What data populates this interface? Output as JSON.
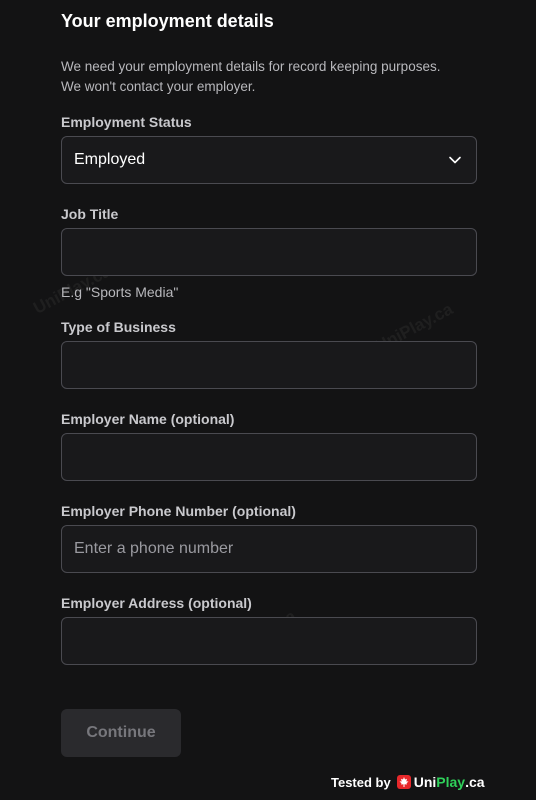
{
  "form": {
    "title": "Your employment details",
    "intro_line1": "We need your employment details for record keeping purposes.",
    "intro_line2": "We won't contact your employer.",
    "employment_status": {
      "label": "Employment Status",
      "value": "Employed"
    },
    "job_title": {
      "label": "Job Title",
      "value": "",
      "placeholder": "",
      "hint": "E.g \"Sports Media\""
    },
    "type_of_business": {
      "label": "Type of Business",
      "value": "",
      "placeholder": ""
    },
    "employer_name": {
      "label": "Employer Name (optional)",
      "value": "",
      "placeholder": ""
    },
    "employer_phone": {
      "label": "Employer Phone Number (optional)",
      "value": "",
      "placeholder": "Enter a phone number"
    },
    "employer_address": {
      "label": "Employer Address (optional)",
      "value": "",
      "placeholder": ""
    },
    "continue_label": "Continue"
  },
  "footer": {
    "tested_by": "Tested by",
    "brand_uni": "Uni",
    "brand_play": "Play",
    "brand_ca": ".ca"
  },
  "watermarks": [
    "UniPlay.ca",
    "UniPlay.ca",
    "UniPlay.ca"
  ],
  "colors": {
    "background": "#131314",
    "accent_green": "#2fd05a",
    "leaf_red": "#e8282b"
  },
  "icons": {
    "select_chevron": "chevron-down-icon",
    "brand_leaf": "maple-leaf-icon"
  }
}
